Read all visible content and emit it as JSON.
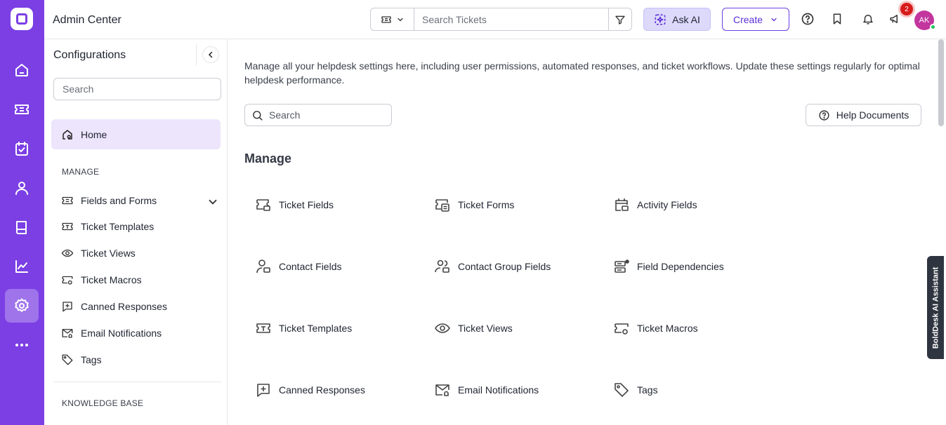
{
  "header": {
    "app_title": "Admin Center",
    "search_placeholder": "Search Tickets",
    "ask_ai_label": "Ask AI",
    "create_label": "Create",
    "notification_count": "2",
    "avatar_initials": "AK"
  },
  "rail": {
    "items": [
      "home-icon",
      "tickets-icon",
      "tasks-icon",
      "contacts-icon",
      "knowledge-base-icon",
      "reports-icon",
      "settings-icon",
      "more-icon"
    ],
    "active": "settings-icon",
    "color": "#7b3fe4"
  },
  "config": {
    "title": "Configurations",
    "search_placeholder": "Search",
    "home_label": "Home",
    "manage_label": "MANAGE",
    "items": [
      {
        "label": "Fields and Forms",
        "icon": "fields-forms-icon"
      },
      {
        "label": "Ticket Templates",
        "icon": "ticket-template-icon"
      },
      {
        "label": "Ticket Views",
        "icon": "eye-icon"
      },
      {
        "label": "Ticket Macros",
        "icon": "macro-icon"
      },
      {
        "label": "Canned Responses",
        "icon": "canned-response-icon"
      },
      {
        "label": "Email Notifications",
        "icon": "email-notification-icon"
      },
      {
        "label": "Tags",
        "icon": "tag-icon"
      }
    ],
    "knowledge_base_label": "KNOWLEDGE BASE"
  },
  "main": {
    "description": "Manage all your helpdesk settings here, including user permissions, automated responses, and ticket workflows. Update these settings regularly for optimal helpdesk performance.",
    "search_placeholder": "Search",
    "help_label": "Help Documents",
    "section_title": "Manage",
    "cards": [
      {
        "label": "Ticket Fields",
        "icon": "ticket-fields-icon"
      },
      {
        "label": "Ticket Forms",
        "icon": "ticket-forms-icon"
      },
      {
        "label": "Activity Fields",
        "icon": "activity-fields-icon"
      },
      {
        "label": "Contact Fields",
        "icon": "contact-fields-icon"
      },
      {
        "label": "Contact Group Fields",
        "icon": "contact-group-fields-icon"
      },
      {
        "label": "Field Dependencies",
        "icon": "field-dependencies-icon"
      },
      {
        "label": "Ticket Templates",
        "icon": "ticket-template-icon"
      },
      {
        "label": "Ticket Views",
        "icon": "eye-icon"
      },
      {
        "label": "Ticket Macros",
        "icon": "macro-icon"
      },
      {
        "label": "Canned Responses",
        "icon": "canned-response-icon"
      },
      {
        "label": "Email Notifications",
        "icon": "email-notification-icon"
      },
      {
        "label": "Tags",
        "icon": "tag-icon"
      }
    ]
  },
  "assistant": {
    "label": "BoldDesk AI Assistant"
  }
}
